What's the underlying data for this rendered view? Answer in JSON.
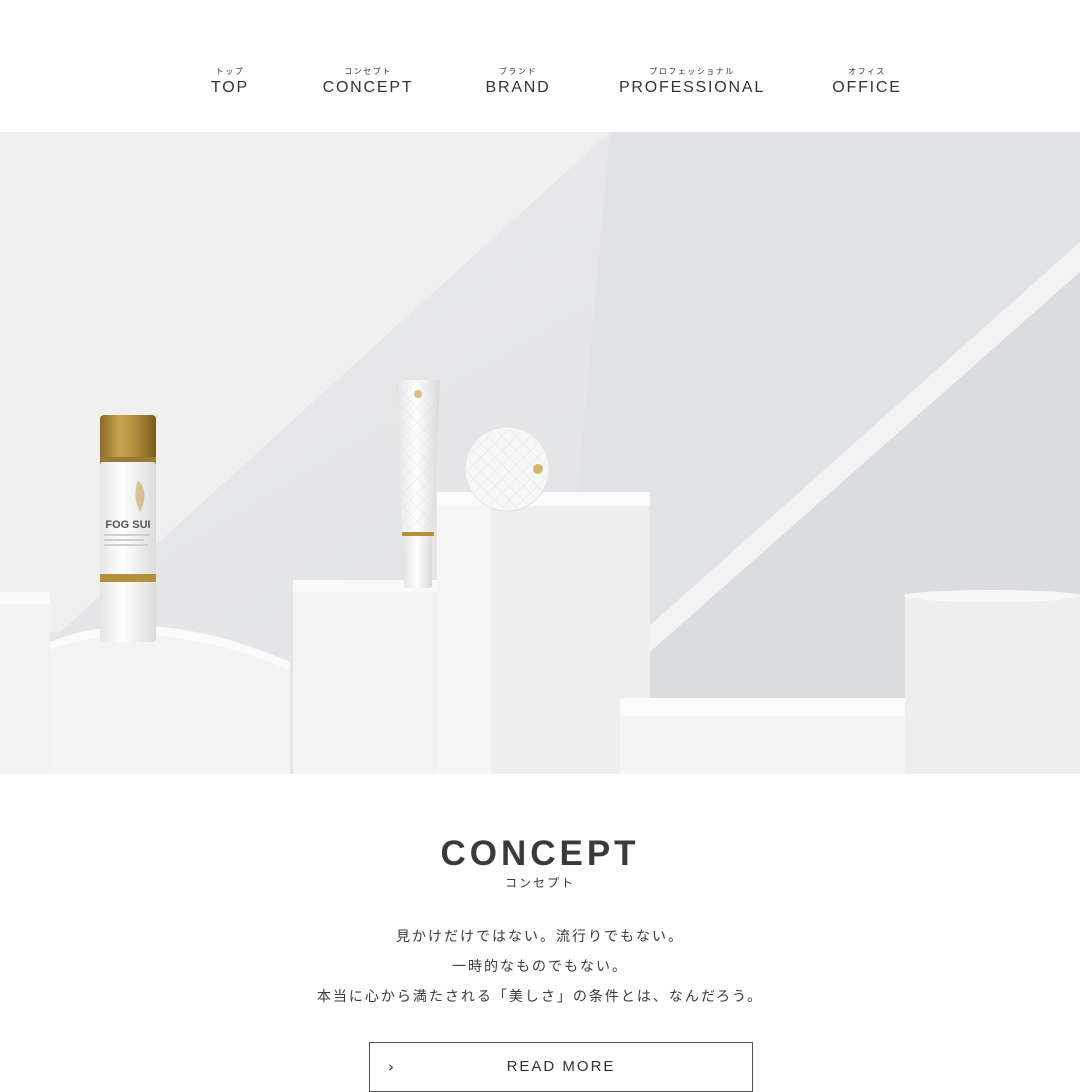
{
  "nav": {
    "items": [
      {
        "kana": "トップ",
        "label": "TOP"
      },
      {
        "kana": "コンセプト",
        "label": "CONCEPT"
      },
      {
        "kana": "ブランド",
        "label": "BRAND"
      },
      {
        "kana": "プロフェッショナル",
        "label": "PROFESSIONAL"
      },
      {
        "kana": "オフィス",
        "label": "OFFICE"
      }
    ]
  },
  "hero": {
    "spray_brand": "FOG SUI",
    "accent_gold": "#b58f3c"
  },
  "concept": {
    "title": "CONCEPT",
    "kana": "コンセプト",
    "lines": [
      "見かけだけではない。流行りでもない。",
      "一時的なものでもない。",
      "本当に心から満たされる「美しさ」の条件とは、なんだろう。"
    ],
    "read_more": "READ MORE",
    "read_more_icon": "chevron-right-icon"
  }
}
